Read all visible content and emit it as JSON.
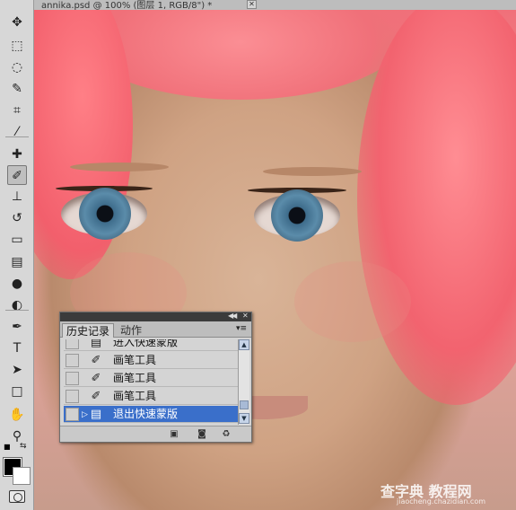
{
  "document": {
    "title": "annika.psd @ 100% (图层 1, RGB/8\") *",
    "close_glyph": "✕"
  },
  "toolbar": {
    "tools": [
      {
        "name": "move-tool-icon",
        "glyph": "✥",
        "active": false
      },
      {
        "name": "marquee-tool-icon",
        "glyph": "⬚",
        "active": false
      },
      {
        "name": "lasso-tool-icon",
        "glyph": "◌",
        "active": false
      },
      {
        "name": "quick-selection-tool-icon",
        "glyph": "✎",
        "active": false
      },
      {
        "name": "crop-tool-icon",
        "glyph": "⌗",
        "active": false
      },
      {
        "name": "eyedropper-tool-icon",
        "glyph": "⁄",
        "active": false
      },
      {
        "name": "healing-brush-tool-icon",
        "glyph": "✚",
        "active": false
      },
      {
        "name": "brush-tool-icon",
        "glyph": "✐",
        "active": true
      },
      {
        "name": "clone-stamp-tool-icon",
        "glyph": "⊥",
        "active": false
      },
      {
        "name": "history-brush-tool-icon",
        "glyph": "↺",
        "active": false
      },
      {
        "name": "eraser-tool-icon",
        "glyph": "▭",
        "active": false
      },
      {
        "name": "gradient-tool-icon",
        "glyph": "▤",
        "active": false
      },
      {
        "name": "blur-tool-icon",
        "glyph": "●",
        "active": false
      },
      {
        "name": "dodge-tool-icon",
        "glyph": "◐",
        "active": false
      },
      {
        "name": "pen-tool-icon",
        "glyph": "✒",
        "active": false
      },
      {
        "name": "type-tool-icon",
        "glyph": "T",
        "active": false
      },
      {
        "name": "path-selection-tool-icon",
        "glyph": "➤",
        "active": false
      },
      {
        "name": "shape-tool-icon",
        "glyph": "□",
        "active": false
      },
      {
        "name": "hand-tool-icon",
        "glyph": "✋",
        "active": false
      },
      {
        "name": "zoom-tool-icon",
        "glyph": "⚲",
        "active": false
      }
    ],
    "colors": {
      "foreground": "#000000",
      "background": "#ffffff"
    }
  },
  "history_panel": {
    "tabs": [
      {
        "label": "历史记录",
        "active": true
      },
      {
        "label": "动作",
        "active": false
      }
    ],
    "items": [
      {
        "icon": "snapshot-step-icon",
        "glyph": "▤",
        "label": "进入快速蒙版",
        "selected": false
      },
      {
        "icon": "brush-step-icon",
        "glyph": "✐",
        "label": "画笔工具",
        "selected": false
      },
      {
        "icon": "brush-step-icon",
        "glyph": "✐",
        "label": "画笔工具",
        "selected": false
      },
      {
        "icon": "brush-step-icon",
        "glyph": "✐",
        "label": "画笔工具",
        "selected": false
      },
      {
        "icon": "snapshot-step-icon",
        "glyph": "▤",
        "label": "退出快速蒙版",
        "selected": true
      }
    ],
    "selected_color": "#3a6fca"
  },
  "watermark": {
    "main": "查字典 教程网",
    "sub": "jiaocheng.chazidian.com"
  }
}
